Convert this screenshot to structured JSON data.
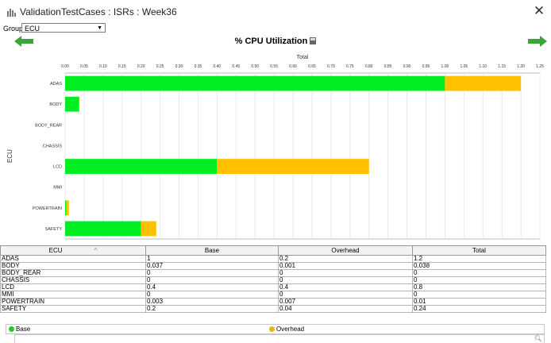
{
  "window": {
    "title": "ValidationTestCases : ISRs : Week36",
    "close_glyph": "✕",
    "app_icon": "bar-chart-icon"
  },
  "toolbar": {
    "group_label": "Group",
    "group_value": "ECU",
    "prev_icon": "arrow-left-icon",
    "next_icon": "arrow-right-icon"
  },
  "chart_data": {
    "type": "bar",
    "orientation": "horizontal",
    "stacked": true,
    "title": "% CPU Utilization",
    "top_axis_label": "Total",
    "ylabel": "ECU",
    "categories": [
      "ADAS",
      "BODY",
      "BODY_REAR",
      "CHASSIS",
      "LCD",
      "MMI",
      "POWERTRAIN",
      "SAFETY"
    ],
    "series": [
      {
        "name": "Base",
        "values": [
          1,
          0.037,
          0,
          0,
          0.4,
          0,
          0.003,
          0.2
        ],
        "color": "#00ee22"
      },
      {
        "name": "Overhead",
        "values": [
          0.2,
          0.001,
          0,
          0,
          0.4,
          0,
          0.007,
          0.04
        ],
        "color": "#ffc000"
      }
    ],
    "xlim": [
      0,
      1.25
    ],
    "xticks": [
      "0.00",
      "0.05",
      "0.10",
      "0.15",
      "0.20",
      "0.25",
      "0.30",
      "0.35",
      "0.40",
      "0.45",
      "0.50",
      "0.55",
      "0.60",
      "0.65",
      "0.70",
      "0.75",
      "0.80",
      "0.85",
      "0.90",
      "0.95",
      "1.00",
      "1.05",
      "1.10",
      "1.15",
      "1.20",
      "1.25"
    ],
    "grid": true,
    "legend": "bottom"
  },
  "table": {
    "headers": [
      "ECU",
      "Base",
      "Overhead",
      "Total"
    ],
    "sort_glyph": "^",
    "rows": [
      [
        "ADAS",
        "1",
        "0.2",
        "1.2"
      ],
      [
        "BODY",
        "0.037",
        "0.001",
        "0.038"
      ],
      [
        "BODY_REAR",
        "0",
        "0",
        "0"
      ],
      [
        "CHASSIS",
        "0",
        "0",
        "0"
      ],
      [
        "LCD",
        "0.4",
        "0.4",
        "0.8"
      ],
      [
        "MMI",
        "0",
        "0",
        "0"
      ],
      [
        "POWERTRAIN",
        "0.003",
        "0.007",
        "0.01"
      ],
      [
        "SAFETY",
        "0.2",
        "0.04",
        "0.24"
      ]
    ]
  },
  "legend": {
    "items": [
      {
        "label": "Base",
        "color": "#22cc22"
      },
      {
        "label": "Overhead",
        "color": "#e6b800"
      }
    ]
  },
  "bottom_icon": "zoom-icon"
}
